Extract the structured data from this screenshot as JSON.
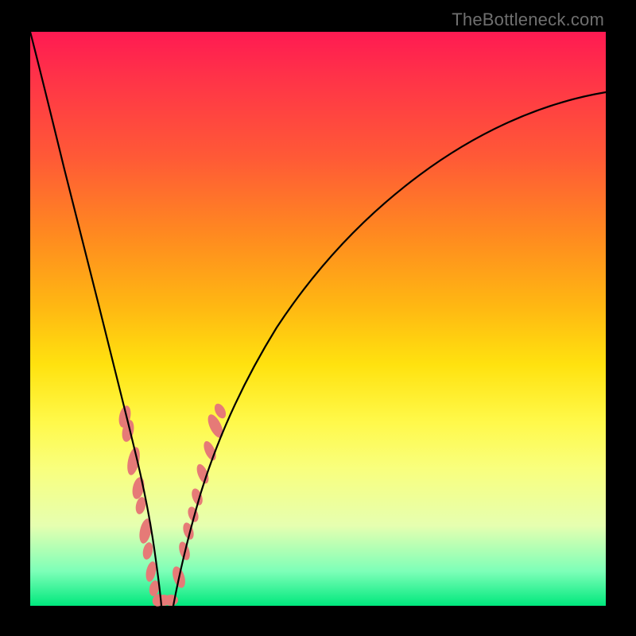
{
  "watermark": "TheBottleneck.com",
  "colors": {
    "blob": "#e67a77",
    "curve": "#000000",
    "background": "#000000"
  },
  "chart_data": {
    "type": "line",
    "title": "",
    "xlabel": "",
    "ylabel": "",
    "axes_visible": false,
    "description": "Two black V-shaped curves forming a valley near x≈0.22 reaching y≈0. Left branch descends steeply from top-left corner; right branch rises with decreasing slope toward upper right. Salmon blobs highlight lower segments of both branches where the curve is near the valley floor.",
    "xlim": [
      0,
      1
    ],
    "ylim": [
      0,
      1
    ],
    "series": [
      {
        "name": "left-branch",
        "x": [
          0.0,
          0.02,
          0.04,
          0.06,
          0.08,
          0.1,
          0.12,
          0.14,
          0.16,
          0.18,
          0.2,
          0.21,
          0.218
        ],
        "y": [
          1.0,
          0.92,
          0.84,
          0.76,
          0.67,
          0.575,
          0.48,
          0.385,
          0.29,
          0.195,
          0.095,
          0.04,
          0.0
        ]
      },
      {
        "name": "right-branch",
        "x": [
          0.245,
          0.26,
          0.28,
          0.3,
          0.33,
          0.37,
          0.42,
          0.48,
          0.55,
          0.63,
          0.72,
          0.82,
          0.92,
          1.0
        ],
        "y": [
          0.0,
          0.06,
          0.13,
          0.195,
          0.28,
          0.37,
          0.455,
          0.54,
          0.615,
          0.685,
          0.75,
          0.81,
          0.86,
          0.895
        ]
      },
      {
        "name": "valley-flat",
        "x": [
          0.218,
          0.245
        ],
        "y": [
          0.0,
          0.0
        ]
      }
    ],
    "highlight_blobs": {
      "note": "Approximate (x,y) centers of salmon blobs along the curves, bottom-origin normalized",
      "points": [
        {
          "x": 0.165,
          "y": 0.33
        },
        {
          "x": 0.17,
          "y": 0.305
        },
        {
          "x": 0.18,
          "y": 0.252
        },
        {
          "x": 0.188,
          "y": 0.205
        },
        {
          "x": 0.192,
          "y": 0.175
        },
        {
          "x": 0.2,
          "y": 0.13
        },
        {
          "x": 0.205,
          "y": 0.095
        },
        {
          "x": 0.21,
          "y": 0.06
        },
        {
          "x": 0.215,
          "y": 0.03
        },
        {
          "x": 0.222,
          "y": 0.01
        },
        {
          "x": 0.232,
          "y": 0.01
        },
        {
          "x": 0.245,
          "y": 0.01
        },
        {
          "x": 0.258,
          "y": 0.05
        },
        {
          "x": 0.268,
          "y": 0.095
        },
        {
          "x": 0.275,
          "y": 0.13
        },
        {
          "x": 0.283,
          "y": 0.16
        },
        {
          "x": 0.29,
          "y": 0.19
        },
        {
          "x": 0.3,
          "y": 0.23
        },
        {
          "x": 0.312,
          "y": 0.27
        },
        {
          "x": 0.322,
          "y": 0.313
        },
        {
          "x": 0.33,
          "y": 0.34
        }
      ]
    },
    "gradient_stops": [
      {
        "pos": 0.0,
        "color": "#ff1a52"
      },
      {
        "pos": 0.08,
        "color": "#ff3348"
      },
      {
        "pos": 0.22,
        "color": "#ff5a36"
      },
      {
        "pos": 0.36,
        "color": "#ff8c1f"
      },
      {
        "pos": 0.48,
        "color": "#ffb812"
      },
      {
        "pos": 0.58,
        "color": "#ffe20f"
      },
      {
        "pos": 0.68,
        "color": "#fff94a"
      },
      {
        "pos": 0.76,
        "color": "#f9ff7d"
      },
      {
        "pos": 0.86,
        "color": "#e6ffb0"
      },
      {
        "pos": 0.94,
        "color": "#7dffb8"
      },
      {
        "pos": 1.0,
        "color": "#00e87d"
      }
    ]
  }
}
